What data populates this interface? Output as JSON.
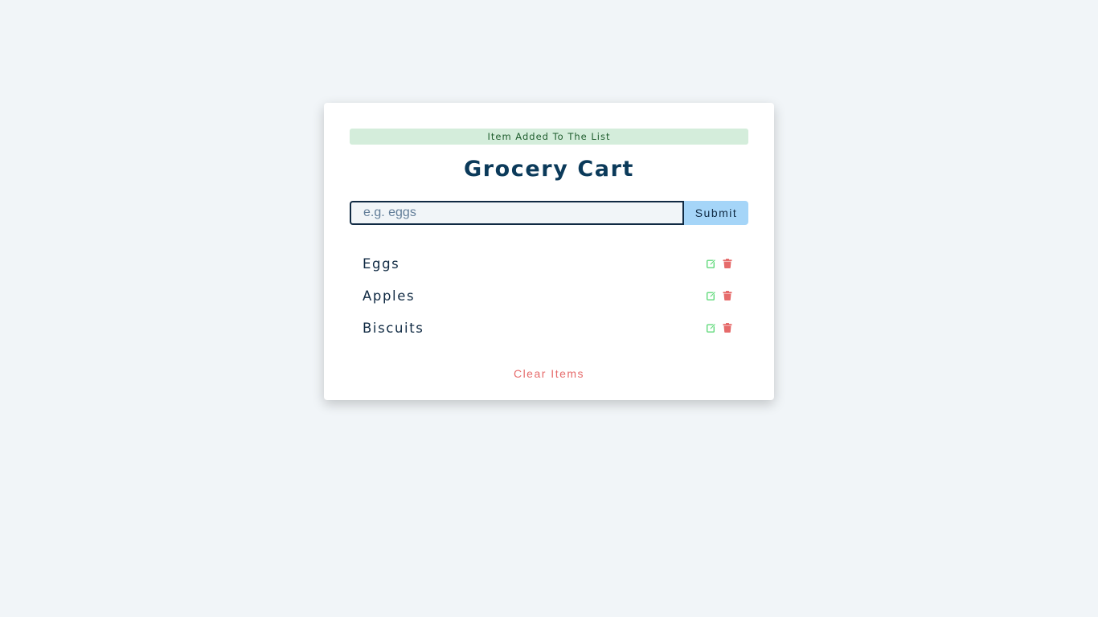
{
  "alert": {
    "text": "Item Added To The List",
    "color": "#1d5c2c",
    "background": "#d4eddb"
  },
  "header": {
    "title": "Grocery Cart"
  },
  "form": {
    "input_value": "",
    "placeholder": "e.g. eggs",
    "submit_label": "Submit"
  },
  "items": [
    {
      "name": "Eggs",
      "edit_icon": "edit-icon",
      "delete_icon": "trash-icon"
    },
    {
      "name": "Apples",
      "edit_icon": "edit-icon",
      "delete_icon": "trash-icon"
    },
    {
      "name": "Biscuits",
      "edit_icon": "edit-icon",
      "delete_icon": "trash-icon"
    }
  ],
  "clear_label": "Clear Items",
  "colors": {
    "accent": "#a5d5f8",
    "title": "#0b3a5a",
    "edit": "#5fd97a",
    "delete": "#e66b6b",
    "background": "#f1f5f8"
  }
}
